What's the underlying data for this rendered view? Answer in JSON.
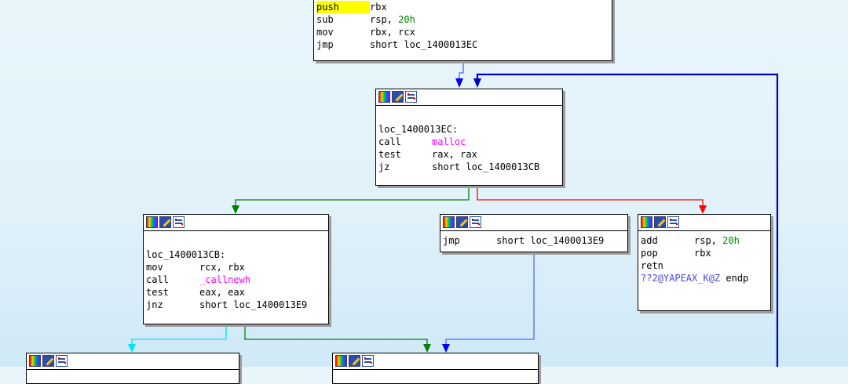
{
  "nodes": {
    "entry": {
      "lines": [
        {
          "mnem": "push",
          "ops": "rbx"
        },
        {
          "mnem": "sub",
          "ops": "rsp, ",
          "num": "20h"
        },
        {
          "mnem": "mov",
          "ops": "rbx, rcx"
        },
        {
          "mnem": "jmp",
          "ops": "short loc_1400013EC"
        }
      ]
    },
    "loop": {
      "label": "loc_1400013EC:",
      "lines": [
        {
          "mnem": "call",
          "ops": "malloc"
        },
        {
          "mnem": "test",
          "ops": "rax, rax"
        },
        {
          "mnem": "jz",
          "ops": "short loc_1400013CB"
        }
      ]
    },
    "newh": {
      "label": "loc_1400013CB:",
      "lines": [
        {
          "mnem": "mov",
          "ops": "rcx, rbx"
        },
        {
          "mnem": "call",
          "ops": "_callnewh"
        },
        {
          "mnem": "test",
          "ops": "eax, eax"
        },
        {
          "mnem": "jnz",
          "ops": "short loc_1400013E9"
        }
      ]
    },
    "jmpnode": {
      "lines": [
        {
          "mnem": "jmp",
          "ops": "short loc_1400013E9"
        }
      ]
    },
    "ret": {
      "lines": [
        {
          "mnem": "add",
          "ops": "rsp, ",
          "num": "20h"
        },
        {
          "mnem": "pop",
          "ops": "rbx"
        },
        {
          "mnem": "retn",
          "ops": ""
        }
      ],
      "endp_symbol": "??2@YAPEAX_K@Z",
      "endp_keyword": " endp"
    }
  },
  "colors": {
    "unconditional": "#0000ff",
    "true_branch": "#008000",
    "false_branch": "#ff0000",
    "other": "#00e5ff",
    "loop_back": "#0000cc"
  }
}
